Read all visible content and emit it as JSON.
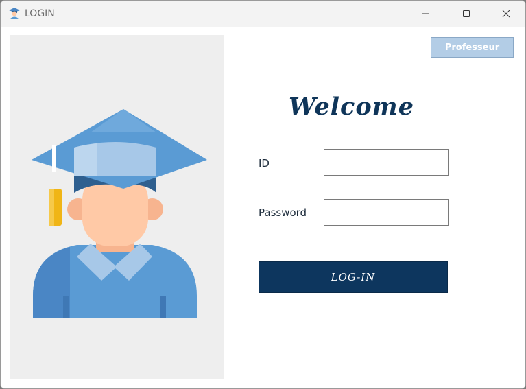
{
  "window": {
    "title": "LOGIN",
    "app_icon": "graduate-icon",
    "controls": {
      "minimize": "minimize-icon",
      "maximize": "maximize-icon",
      "close": "close-icon"
    }
  },
  "illustration": {
    "icon": "graduate-student-icon"
  },
  "header": {
    "professor_button_label": "Professeur"
  },
  "form": {
    "welcome_text": "Welcome",
    "id_label": "ID",
    "id_value": "",
    "password_label": "Password",
    "password_value": "",
    "login_button_label": "LOG-IN"
  },
  "colors": {
    "primary_dark": "#0d365e",
    "professor_button": "#b3cde6",
    "panel_gray": "#eeeeee",
    "cap_blue": "#5a9bd4",
    "skin": "#ffc9a6"
  }
}
